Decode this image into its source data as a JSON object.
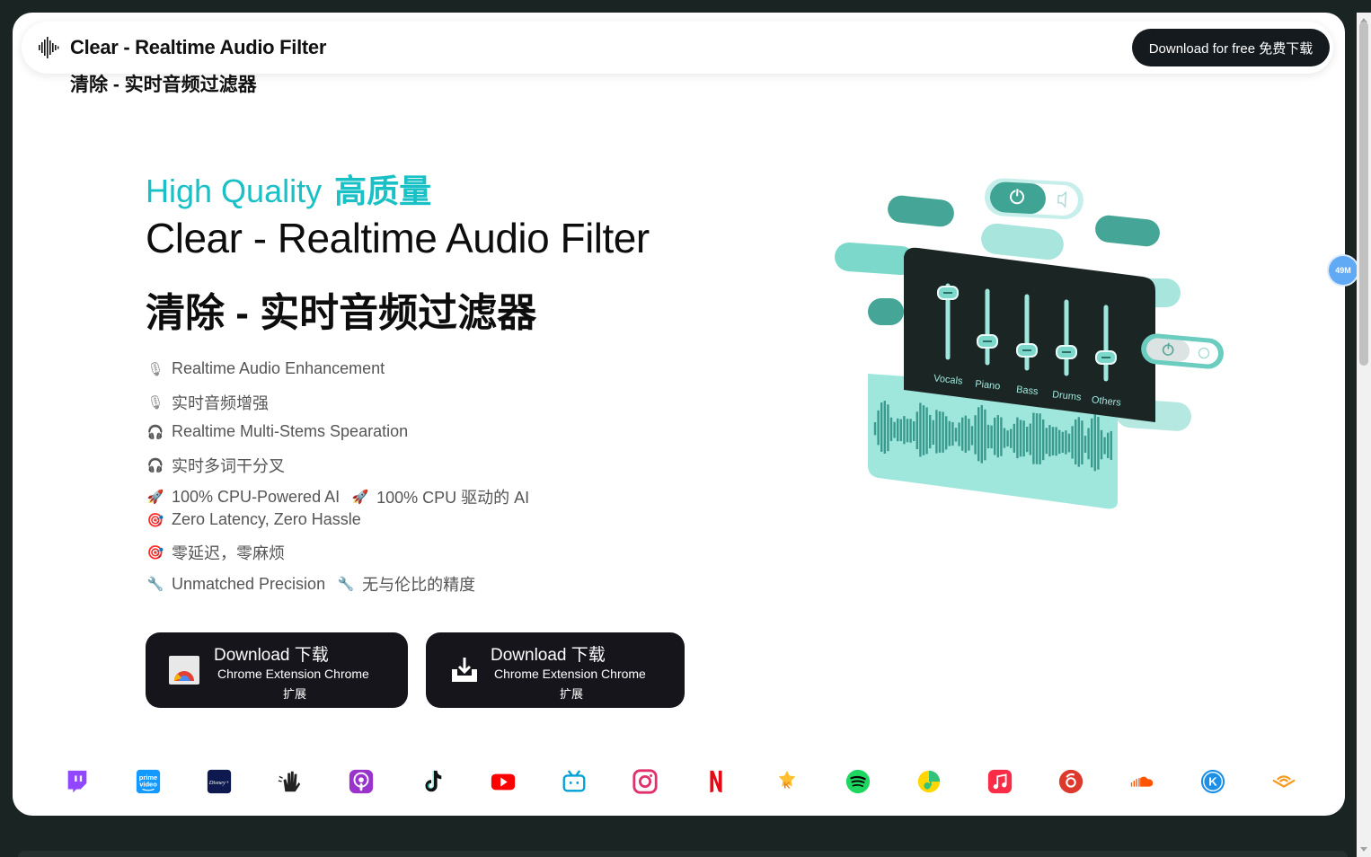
{
  "header": {
    "title": "Clear - Realtime Audio Filter",
    "title_cn": "清除 - 实时音频过滤器",
    "download_button": "Download for free  免费下载"
  },
  "hero": {
    "eyebrow_en": "High Quality",
    "eyebrow_cn": "高质量",
    "title": "Clear - Realtime Audio Filter",
    "title_cn": "清除 - 实时音频过滤器",
    "accent_color": "#19c0c6"
  },
  "features": [
    {
      "icon": "microphone-icon",
      "text": "Realtime Audio Enhancement"
    },
    {
      "icon": "microphone-icon",
      "text": "实时音频增强"
    },
    {
      "icon": "headphones-icon",
      "text": "Realtime Multi-Stems Spearation"
    },
    {
      "icon": "headphones-icon",
      "text": "实时多词干分叉"
    },
    {
      "icon": "rocket-icon",
      "text": "100% CPU-Powered AI",
      "icon2": "rocket-icon",
      "text2": "100% CPU 驱动的 AI"
    },
    {
      "icon": "target-icon",
      "text": "Zero Latency, Zero Hassle"
    },
    {
      "icon": "target-icon",
      "text": "零延迟，零麻烦"
    },
    {
      "icon": "wrench-icon",
      "text": "Unmatched Precision",
      "icon2": "wrench-icon",
      "text2": "无与伦比的精度"
    }
  ],
  "downloads": [
    {
      "line1": "Download  下载",
      "line2": "Chrome Extension  Chrome",
      "line3": "扩展",
      "icon": "chrome-icon"
    },
    {
      "line1": "Download  下载",
      "line2": "Chrome Extension  Chrome",
      "line3": "扩展",
      "icon": "download-tray-icon"
    }
  ],
  "mixer": {
    "channels": [
      "Vocals",
      "Piano",
      "Bass",
      "Drums",
      "Others"
    ],
    "levels": [
      0.9,
      0.3,
      0.25,
      0.3,
      0.3
    ]
  },
  "platforms": [
    "twitch-icon",
    "prime-video-icon",
    "disney-plus-icon",
    "hand-wave-icon",
    "podcasts-icon",
    "tiktok-icon",
    "youtube-icon",
    "bilibili-icon",
    "instagram-icon",
    "netflix-icon",
    "kuwo-icon",
    "spotify-icon",
    "qq-music-icon",
    "apple-music-icon",
    "netease-music-icon",
    "soundcloud-icon",
    "kugou-icon",
    "audible-icon"
  ],
  "side_badge": "49M"
}
